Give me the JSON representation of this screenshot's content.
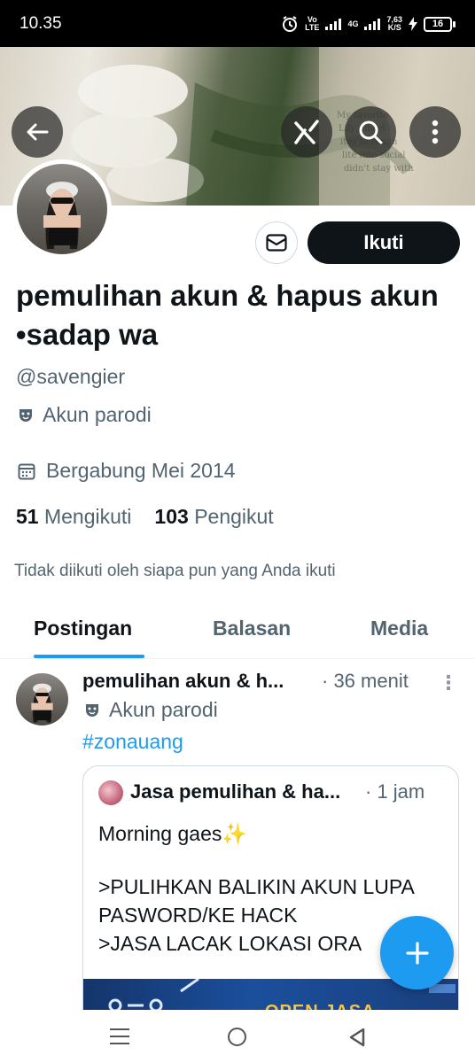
{
  "status_bar": {
    "time": "10.35",
    "volte": "Vo",
    "lte": "LTE",
    "network": "4G",
    "speed_value": "7,63",
    "speed_unit": "K/S",
    "battery": "16"
  },
  "banner": {
    "icons": [
      "back-arrow-icon",
      "grok-icon",
      "search-icon",
      "more-vertical-icon"
    ]
  },
  "profile": {
    "name": "pemulihan akun & hapus akun •sadap wa",
    "handle": "@savengier",
    "parody_label": "Akun parodi",
    "joined": "Bergabung Mei 2014",
    "following_count": "51",
    "following_label": "Mengikuti",
    "followers_count": "103",
    "followers_label": "Pengikut",
    "not_followed": "Tidak diikuti oleh siapa pun yang Anda ikuti",
    "follow_button": "Ikuti"
  },
  "tabs": [
    {
      "label": "Postingan",
      "active": true
    },
    {
      "label": "Balasan",
      "active": false
    },
    {
      "label": "Media",
      "active": false
    }
  ],
  "post": {
    "author": "pemulihan akun & h...",
    "time": "· 36 menit",
    "parody_label": "Akun parodi",
    "hashtag": "#zonauang",
    "quote": {
      "author": "Jasa pemulihan & ha...",
      "time": "· 1 jam",
      "line1": "Morning gaes✨",
      "line2": ">PULIHKAN BALIKIN AKUN LUPA PASWORD/KE HACK",
      "line3": ">JASA LACAK LOKASI ORA",
      "image_text": "OPEN JASA"
    }
  },
  "colors": {
    "accent": "#1d9bf0",
    "text_primary": "#0f1419",
    "text_secondary": "#536471",
    "border": "#cfd9de"
  }
}
